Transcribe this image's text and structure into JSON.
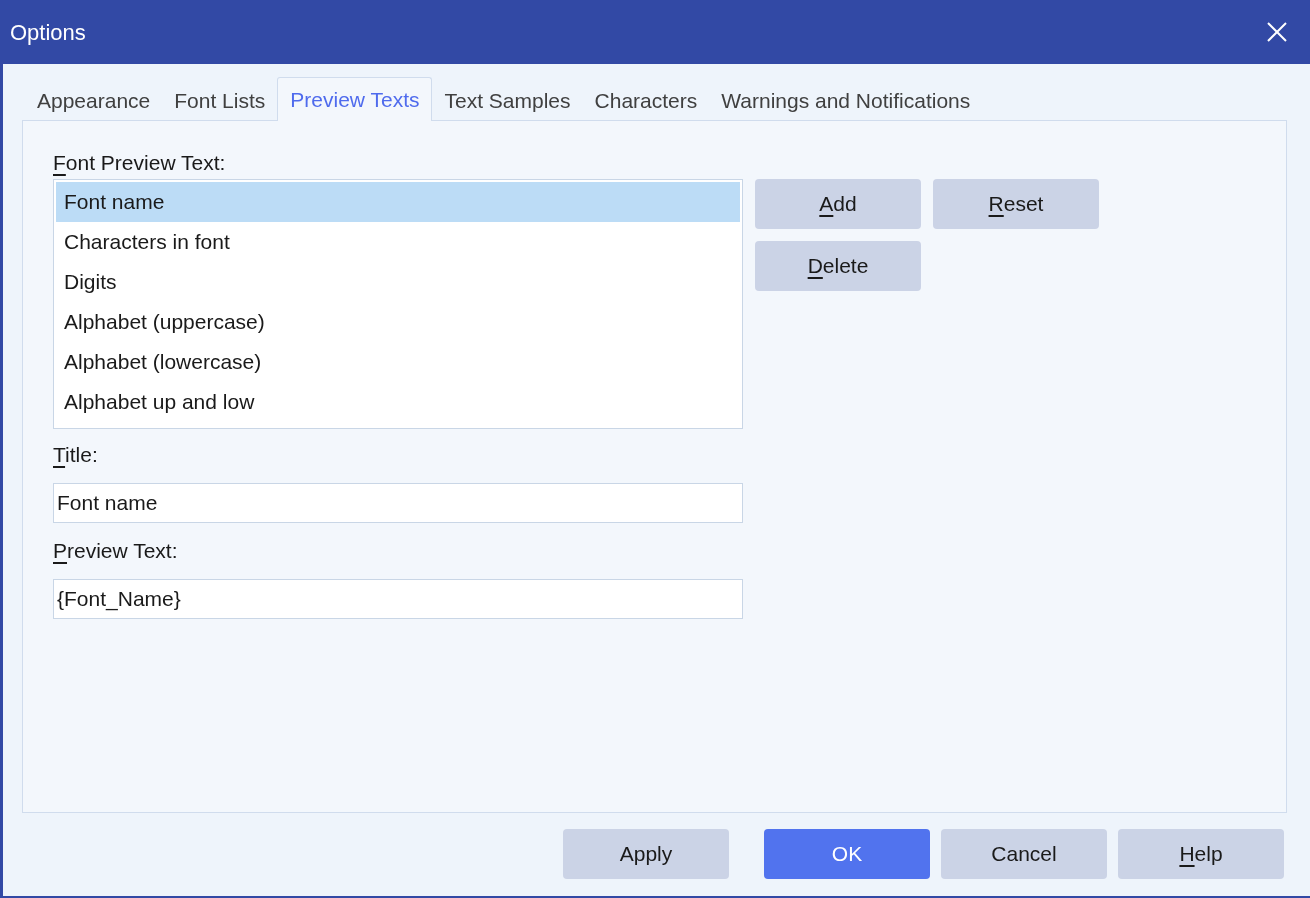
{
  "window": {
    "title": "Options"
  },
  "tabs": [
    {
      "label": "Appearance",
      "selected": false
    },
    {
      "label": "Font Lists",
      "selected": false
    },
    {
      "label": "Preview Texts",
      "selected": true
    },
    {
      "label": "Text Samples",
      "selected": false
    },
    {
      "label": "Characters",
      "selected": false
    },
    {
      "label": "Warnings and Notifications",
      "selected": false
    }
  ],
  "preview_list": {
    "label": "Font Preview Text:",
    "underline_first": true,
    "items": [
      {
        "label": "Font name",
        "selected": true
      },
      {
        "label": "Characters in font",
        "selected": false
      },
      {
        "label": "Digits",
        "selected": false
      },
      {
        "label": "Alphabet (uppercase)",
        "selected": false
      },
      {
        "label": "Alphabet (lowercase)",
        "selected": false
      },
      {
        "label": "Alphabet up and low",
        "selected": false
      }
    ]
  },
  "list_buttons": [
    {
      "label": "Add",
      "underline_first": true
    },
    {
      "label": "Reset",
      "underline_first": true
    },
    {
      "label": "Delete",
      "underline_first": true
    }
  ],
  "title_field": {
    "label": "Title:",
    "underline_first": true,
    "value": "Font name"
  },
  "preview_field": {
    "label": "Preview Text:",
    "underline_first": true,
    "value": "{Font_Name}"
  },
  "footer_buttons": [
    {
      "label": "Apply",
      "underline_first": false,
      "default": false
    },
    {
      "label": "OK",
      "underline_first": false,
      "default": true
    },
    {
      "label": "Cancel",
      "underline_first": false,
      "default": false
    },
    {
      "label": "Help",
      "underline_first": true,
      "default": false
    }
  ]
}
